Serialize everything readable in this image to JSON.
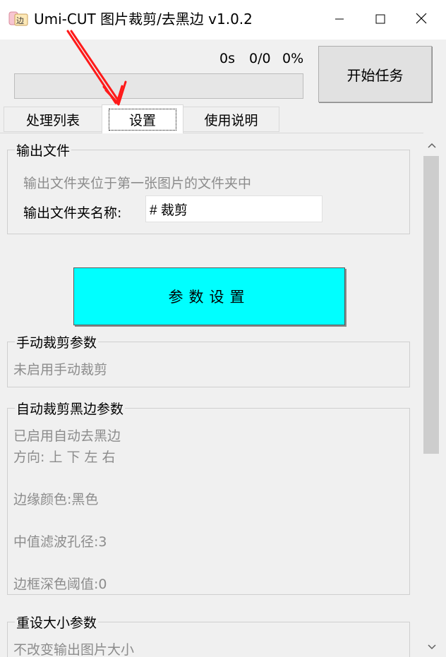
{
  "window": {
    "title": "Umi-CUT 图片裁剪/去黑边 v1.0.2",
    "icon": "umi-app-icon",
    "controls": {
      "minimize_icon": "minimize-icon",
      "maximize_icon": "maximize-icon",
      "close_icon": "close-icon"
    }
  },
  "top": {
    "time": "0s",
    "count": "0/0",
    "percent": "0%",
    "progress": 0,
    "start_button": "开始任务"
  },
  "tabs": [
    {
      "label": "处理列表",
      "selected": false
    },
    {
      "label": "设置",
      "selected": true
    },
    {
      "label": "使用说明",
      "selected": false
    }
  ],
  "settings": {
    "output": {
      "legend": "输出文件",
      "hint": "输出文件夹位于第一张图片的文件夹中",
      "folder_label": "输出文件夹名称:",
      "folder_value": "# 裁剪"
    },
    "param_button": "参数设置",
    "manual": {
      "legend": "手动裁剪参数",
      "status": "未启用手动裁剪"
    },
    "auto": {
      "legend": "自动裁剪黑边参数",
      "enabled": "已启用自动去黑边",
      "direction": "方向: 上 下 左 右",
      "edge_color": "边缘颜色:黑色",
      "median_filter": "中值滤波孔径:3",
      "dark_threshold": "边框深色阈值:0"
    },
    "resize": {
      "legend": "重设大小参数",
      "status": "不改变输出图片大小"
    }
  },
  "colors": {
    "param_button_bg": "#00ffff",
    "annotation_arrow": "#ff0000"
  }
}
